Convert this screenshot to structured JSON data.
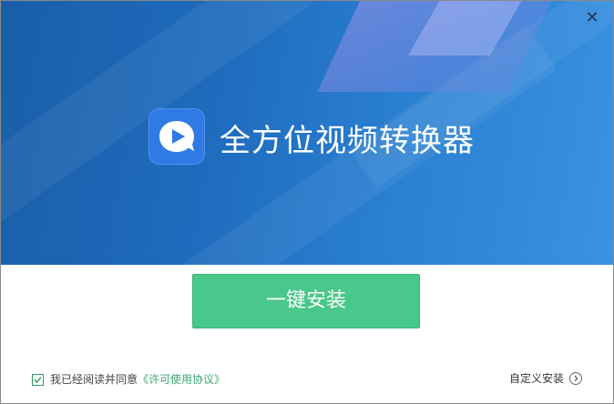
{
  "window": {
    "close_glyph": "✕"
  },
  "app": {
    "title": "全方位视频转换器",
    "logo_color": "#2f7ae5"
  },
  "actions": {
    "install_label": "一键安装",
    "install_color": "#48c88a",
    "custom_install_label": "自定义安装"
  },
  "agreement": {
    "checked": true,
    "text": "我已经阅读并同意",
    "link_label": "《许可使用协议》"
  },
  "colors": {
    "banner_start": "#1a5ea8",
    "banner_end": "#3a92e0",
    "link": "#3aa86e"
  }
}
